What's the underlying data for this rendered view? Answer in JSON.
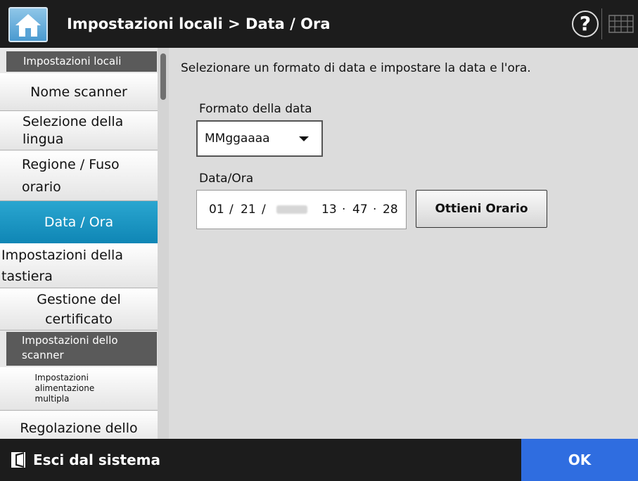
{
  "header": {
    "title": "Impostazioni locali > Data / Ora",
    "help_label": "?"
  },
  "sidebar": {
    "sections": [
      {
        "label": "Impostazioni locali"
      },
      {
        "label": "Impostazioni dello scanner"
      }
    ],
    "items": [
      {
        "label": "Nome scanner"
      },
      {
        "label": "Selezione della lingua"
      },
      {
        "label": "Regione / Fuso orario"
      },
      {
        "label": "Data / Ora",
        "selected": true
      },
      {
        "label": "Impostazioni della tastiera"
      },
      {
        "label": "Gestione del certificato"
      },
      {
        "label": "Impostazioni alimentazione multipla"
      },
      {
        "label": "Regolazione dello"
      }
    ]
  },
  "main": {
    "instruction": "Selezionare un formato di data e impostare la data e l'ora.",
    "date_format": {
      "label": "Formato della data",
      "value": "MMggaaaa"
    },
    "datetime": {
      "label": "Data/Ora",
      "month": "01",
      "day": "21",
      "hour": "13",
      "minute": "47",
      "second": "28",
      "date_sep": "/",
      "time_sep": "·"
    },
    "get_time_button": "Ottieni Orario"
  },
  "footer": {
    "logout_label": "Esci dal sistema",
    "ok_label": "OK"
  },
  "colors": {
    "selected_item": "#1a96c4",
    "ok_button": "#2f6de0",
    "header_bg": "#1c1c1c"
  }
}
